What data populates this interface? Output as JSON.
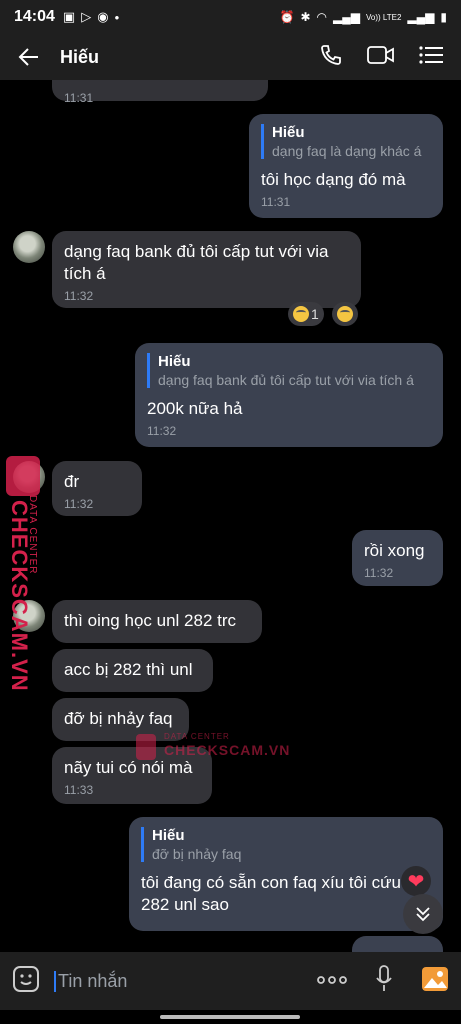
{
  "status_bar": {
    "time": "14:04",
    "left_icons": [
      "gallery-icon",
      "play-store-icon",
      "messenger-icon",
      "dot-icon"
    ],
    "right_icons": [
      "alarm-icon",
      "bluetooth-icon",
      "wifi-icon",
      "signal-icon",
      "signal-icon"
    ],
    "network_label": "Vo)) LTE2"
  },
  "header": {
    "title": "Hiếu"
  },
  "messages": [
    {
      "id": "m0",
      "time": "11:31"
    },
    {
      "id": "m1",
      "reply_name": "Hiếu",
      "reply_text": "dạng faq là dạng khác á",
      "text": "tôi học dạng đó mà",
      "time": "11:31"
    },
    {
      "id": "m2",
      "text": "dạng faq bank đủ tôi cấp tut với via tích á",
      "time": "11:32",
      "reaction_count": "1"
    },
    {
      "id": "m3",
      "reply_name": "Hiếu",
      "reply_text": "dạng faq bank đủ tôi cấp tut với via tích á",
      "text": "200k nữa hả",
      "time": "11:32"
    },
    {
      "id": "m4",
      "text": "đr",
      "time": "11:32"
    },
    {
      "id": "m5",
      "text": "rồi xong",
      "time": "11:32"
    },
    {
      "id": "m6",
      "text": "thì oing học unl 282 trc"
    },
    {
      "id": "m7",
      "text": "acc bị 282 thì unl"
    },
    {
      "id": "m8",
      "text": "đỡ bị nhảy faq"
    },
    {
      "id": "m9",
      "text": "nãy tui có nói mà",
      "time": "11:33"
    },
    {
      "id": "m10",
      "reply_name": "Hiếu",
      "reply_text": "đỡ bị nhảy faq",
      "text": "tôi đang có sẵn con faq xíu tôi cứu 282 unl sao"
    }
  ],
  "watermark": {
    "vertical_brand": "CHECKSCAM.VN",
    "vertical_sub": "DATA CENTER",
    "center_brand": "CHECKSCAM.VN",
    "center_sub": "DATA CENTER"
  },
  "composer": {
    "placeholder": "Tin nhắn"
  },
  "colors": {
    "background": "#000000",
    "bar": "#1f1f1f",
    "incoming_bubble": "#333338",
    "outgoing_bubble": "#3b4150",
    "reply_accent": "#2e7bf6",
    "watermark": "#d4214b"
  }
}
